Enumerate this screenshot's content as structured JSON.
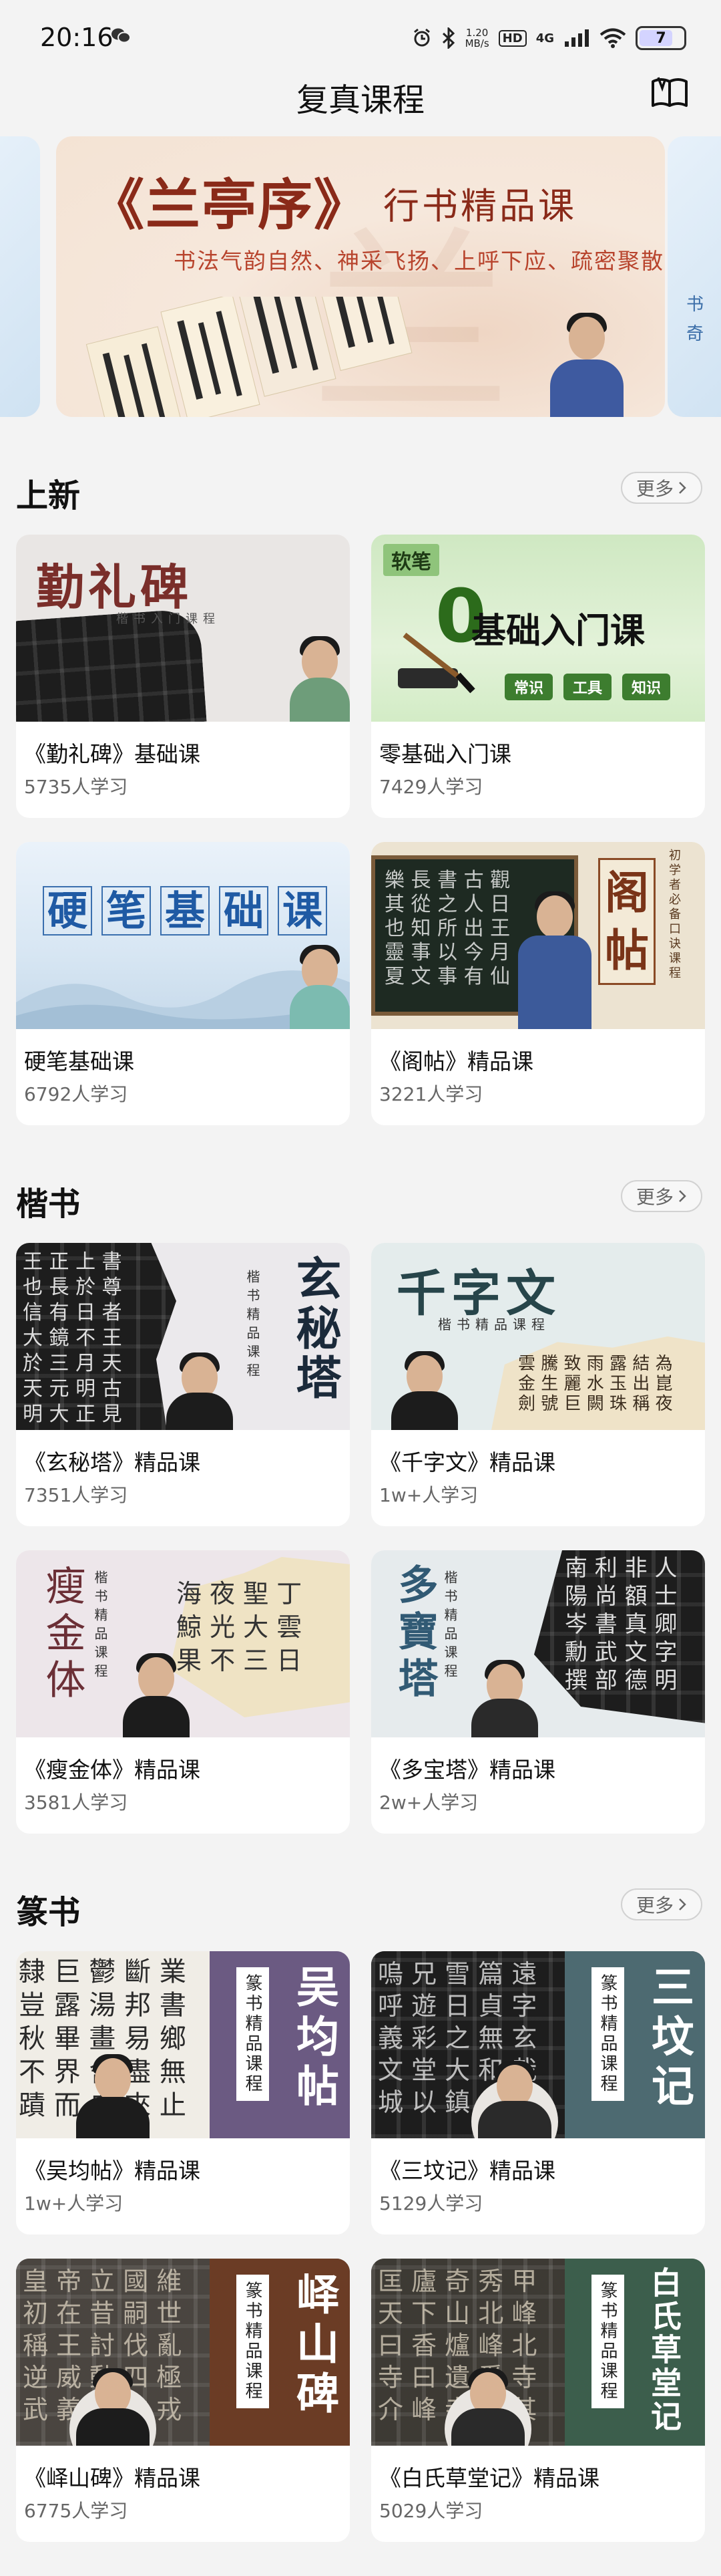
{
  "status_bar": {
    "time": "20:16",
    "network_speed_value": "1.20",
    "network_speed_unit": "MB/s",
    "hd_label": "HD",
    "signal_label": "4G",
    "battery_label": "7"
  },
  "header": {
    "title": "复真课程"
  },
  "banner": {
    "title": "《兰亭序》",
    "badge": "行书精品课",
    "subtitle": "书法气韵自然、神采飞扬、上呼下应、疏密聚散",
    "right_peek_text": "书\n奇"
  },
  "more_label": "更多",
  "sections": [
    {
      "title": "上新",
      "courses": [
        {
          "title": "《勤礼碑》基础课",
          "learners": "5735人学习",
          "art": "勤礼碑",
          "art_sub": "楷书入门课程"
        },
        {
          "title": "零基础入门课",
          "learners": "7429人学习",
          "art_flag": "软笔",
          "art_zero": "0",
          "art": "基础入门课",
          "tags": [
            "常识",
            "工具",
            "知识"
          ]
        },
        {
          "title": "硬笔基础课",
          "learners": "6792人学习",
          "art": "硬笔基础课"
        },
        {
          "title": "《阁帖》精品课",
          "learners": "3221人学习",
          "art": "阁帖",
          "art_sub": "初学者必备口诀课程"
        }
      ]
    },
    {
      "title": "楷书",
      "courses": [
        {
          "title": "《玄秘塔》精品课",
          "learners": "7351人学习",
          "art": "玄秘塔",
          "art_sub": "楷书精品课程"
        },
        {
          "title": "《千字文》精品课",
          "learners": "1w+人学习",
          "art": "千字文",
          "art_sub": "楷书精品课程"
        },
        {
          "title": "《瘦金体》精品课",
          "learners": "3581人学习",
          "art": "瘦金体",
          "art_sub": "楷书精品课程"
        },
        {
          "title": "《多宝塔》精品课",
          "learners": "2w+人学习",
          "art": "多寶塔",
          "art_sub": "楷书精品课程"
        }
      ]
    },
    {
      "title": "篆书",
      "courses": [
        {
          "title": "《吴均帖》精品课",
          "learners": "1w+人学习",
          "art": "吴均帖",
          "art_sub": "篆书精品课程"
        },
        {
          "title": "《三坟记》精品课",
          "learners": "5129人学习",
          "art": "三坟记",
          "art_sub": "篆书精品课程"
        },
        {
          "title": "《峄山碑》精品课",
          "learners": "6775人学习",
          "art": "峄山碑",
          "art_sub": "篆书精品课程"
        },
        {
          "title": "《白氏草堂记》精品课",
          "learners": "5029人学习",
          "art": "白氏草堂记",
          "art_sub": "篆书精品课程"
        }
      ]
    }
  ],
  "colors": {
    "background": "#f3f3f3",
    "banner_accent": "#8a2a19",
    "zhuan_purple": "#6b5a82",
    "zhuan_teal": "#4d6a71",
    "zhuan_brown": "#6b3c25",
    "zhuan_green": "#3c5e4c"
  }
}
